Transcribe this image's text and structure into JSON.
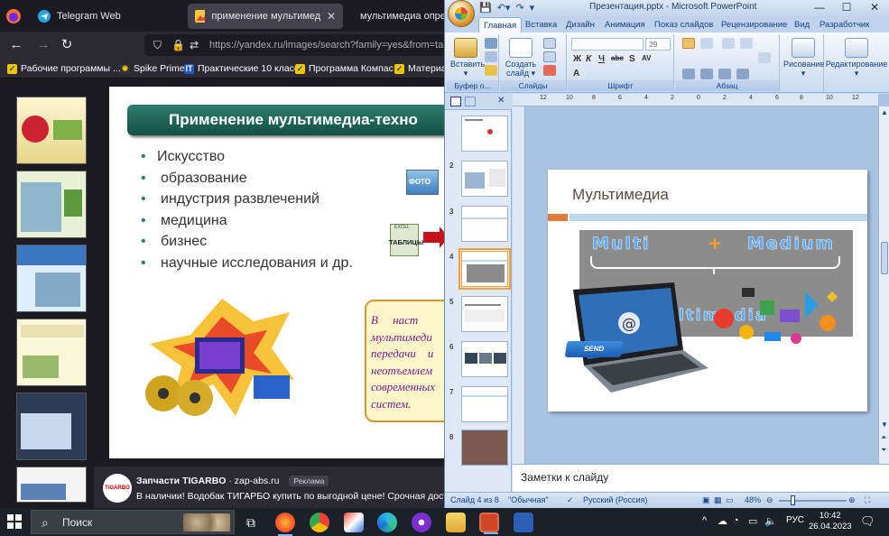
{
  "firefox": {
    "tabs": [
      {
        "label": "Telegram Web",
        "icon": "telegram-icon"
      },
      {
        "label": "применение мультимедийны",
        "icon": "yandex-images-icon",
        "active": true
      },
      {
        "label": "мультимедиа опред",
        "icon": "yandex-icon"
      }
    ],
    "url": "https://yandex.ru/images/search?family=yes&from=tab",
    "bookmarks": [
      "Рабочие программы ...",
      "Spike Prime",
      "Практические 10 класс",
      "Программа Компас",
      "Материал"
    ],
    "slide_preview": {
      "title": "Применение мультимедиа-техно",
      "items": [
        "Искусство",
        "образование",
        "индустрия развлечений",
        "медицина",
        "бизнес",
        "научные исследования и др."
      ],
      "labels": {
        "photo": "ФОТО",
        "tables": "ТАБЛИЦЫ",
        "tables_tag": "EXCEL"
      },
      "note_lines": "В     наст\nмультимеди\nпередачи    и\nнеотъемлем\nсовременных\nсистем."
    },
    "ad": {
      "logo": "TIGARBO",
      "title": "Запчасти TIGARBO",
      "domain": "· zap-abs.ru",
      "tag": "Реклама",
      "text": "В наличии! Водобак ТИГАРБО купить по выгодной цене! Срочная достав"
    }
  },
  "powerpoint": {
    "window_title": "Презентация.pptx - Microsoft PowerPoint",
    "ribbon_tabs": [
      "Главная",
      "Вставка",
      "Дизайн",
      "Анимация",
      "Показ слайдов",
      "Рецензирование",
      "Вид",
      "Разработчик"
    ],
    "active_tab": "Главная",
    "groups": {
      "clipboard": {
        "label": "Буфер о...",
        "paste": "Вставить"
      },
      "slides": {
        "label": "Слайды",
        "new_slide": "Создать слайд ▾"
      },
      "font": {
        "label": "Шрифт",
        "size": "29"
      },
      "paragraph": {
        "label": "Абзац"
      },
      "drawing": {
        "label": "Рисование"
      },
      "editing": {
        "label": "Редактирование"
      }
    },
    "slide_numbers": [
      "2",
      "3",
      "4",
      "5",
      "6",
      "7",
      "8"
    ],
    "ruler": [
      "12",
      "10",
      "8",
      "6",
      "4",
      "2",
      "0",
      "2",
      "4",
      "6",
      "8",
      "10",
      "12"
    ],
    "current_slide": {
      "title": "Мультимедиа",
      "word_multi": "Multi",
      "plus": "+",
      "word_medium": "Medium",
      "word_result": "Multimedia",
      "send": "SEND"
    },
    "notes_placeholder": "Заметки к слайду",
    "status": {
      "slide": "Слайд 4 из 8",
      "theme": "\"Обычная\"",
      "language": "Русский (Россия)",
      "zoom": "48%"
    }
  },
  "taskbar": {
    "search": "Поиск",
    "language": "РУС",
    "time": "10:42",
    "date": "26.04.2023"
  },
  "colors": {
    "accent_orange": "#e07b39",
    "title_brown": "#5a4a42",
    "ribbon_blue": "#15428b"
  }
}
